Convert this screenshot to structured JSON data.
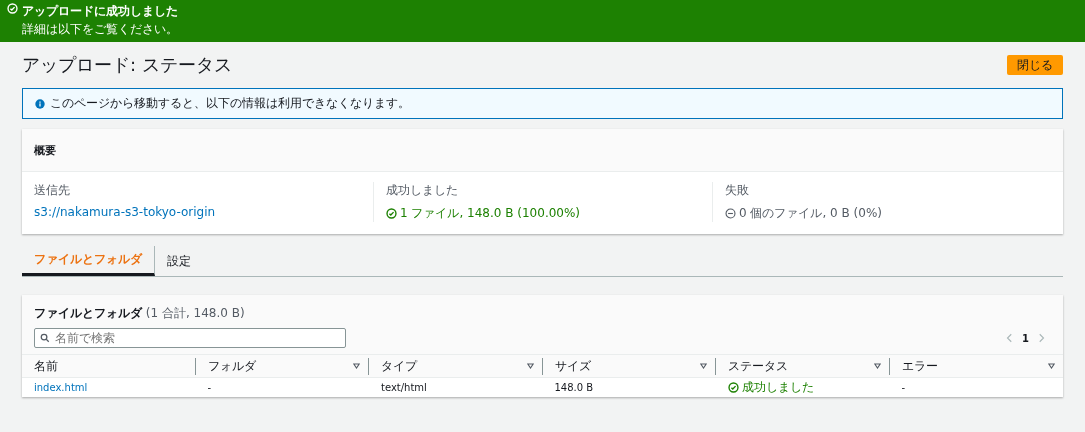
{
  "banner": {
    "title": "アップロードに成功しました",
    "message": "詳細は以下をご覧ください。"
  },
  "page": {
    "title": "アップロード: ステータス",
    "close_button": "閉じる"
  },
  "info": {
    "text": "このページから移動すると、以下の情報は利用できなくなります。"
  },
  "summary": {
    "title": "概要",
    "items": [
      {
        "label": "送信先",
        "value": "s3://nakamura-s3-tokyo-origin",
        "kind": "link"
      },
      {
        "label": "成功しました",
        "value": "1 ファイル, 148.0 B (100.00%)",
        "kind": "success"
      },
      {
        "label": "失敗",
        "value": "0 個のファイル, 0 B (0%)",
        "kind": "failure"
      }
    ]
  },
  "tabs": [
    {
      "label": "ファイルとフォルダ",
      "selected": true
    },
    {
      "label": "設定",
      "selected": false
    }
  ],
  "table": {
    "title": "ファイルとフォルダ",
    "count": "(1 合計, 148.0 B)",
    "search": {
      "placeholder": "名前で検索"
    },
    "page": "1",
    "columns": [
      {
        "label": "名前",
        "sortable": false
      },
      {
        "label": "フォルダ",
        "sortable": true
      },
      {
        "label": "タイプ",
        "sortable": true
      },
      {
        "label": "サイズ",
        "sortable": true
      },
      {
        "label": "ステータス",
        "sortable": true
      },
      {
        "label": "エラー",
        "sortable": true
      }
    ],
    "rows": [
      [
        {
          "kind": "link",
          "text": "index.html"
        },
        {
          "kind": "text",
          "text": "-"
        },
        {
          "kind": "text",
          "text": "text/html"
        },
        {
          "kind": "text",
          "text": "148.0 B"
        },
        {
          "kind": "success",
          "text": "成功しました"
        },
        {
          "kind": "text",
          "text": "-"
        }
      ]
    ]
  }
}
